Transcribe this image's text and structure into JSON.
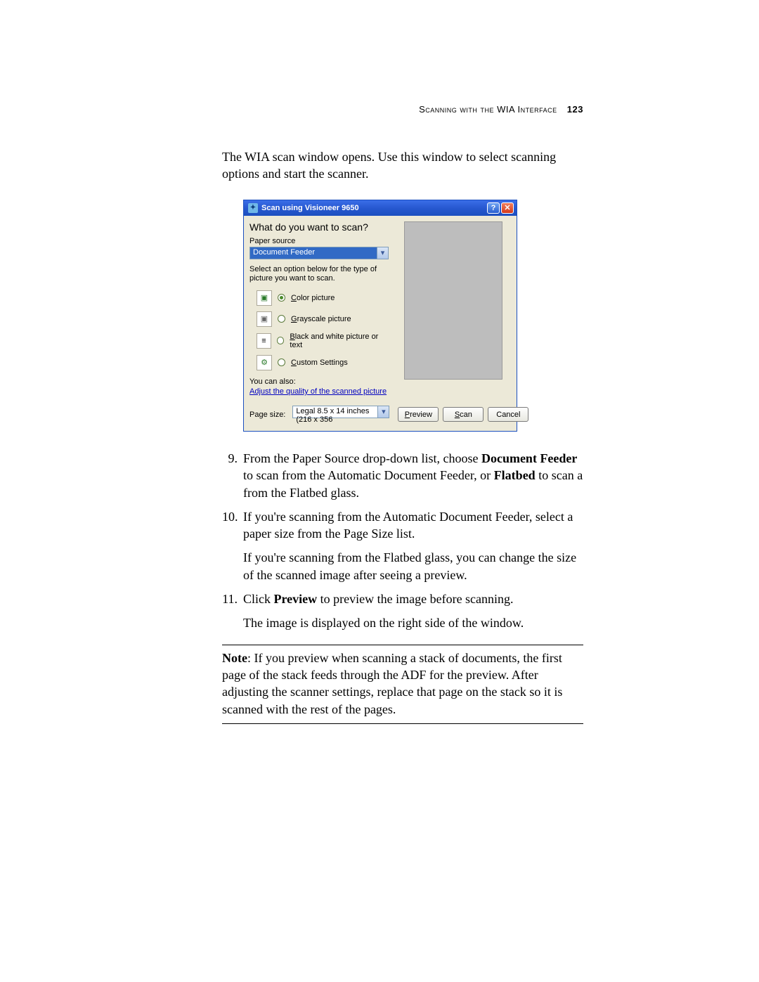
{
  "header": {
    "section": "Scanning with the WIA Interface",
    "page_number": "123"
  },
  "intro": "The WIA scan window opens. Use this window to select scanning options and start the scanner.",
  "dialog": {
    "title": "Scan using Visioneer 9650",
    "heading": "What do you want to scan?",
    "paper_source_label": "Paper source",
    "paper_source_value": "Document Feeder",
    "instruction": "Select an option below for the type of picture you want to scan.",
    "options": {
      "color": {
        "prefix": "C",
        "rest": "olor picture"
      },
      "grayscale": {
        "prefix": "G",
        "rest": "rayscale picture"
      },
      "bw": {
        "prefix": "B",
        "rest": "lack and white picture or text"
      },
      "custom": {
        "prefix": "C",
        "rest": "ustom Settings"
      }
    },
    "you_can_also": "You can also:",
    "adjust_link": "Adjust the quality of the scanned picture",
    "page_size_label": "Page size:",
    "page_size_value": "Legal 8.5 x 14 inches (216 x 356",
    "buttons": {
      "preview": {
        "prefix": "P",
        "rest": "review"
      },
      "scan": {
        "prefix": "S",
        "rest": "can"
      },
      "cancel": "Cancel"
    }
  },
  "steps": {
    "s9": {
      "num": "9.",
      "pre": "From the Paper Source drop-down list, choose ",
      "bold1": "Document Feeder",
      "mid": " to scan from the Automatic Document Feeder, or ",
      "bold2": "Flatbed",
      "post": " to scan a from the Flatbed glass."
    },
    "s10": {
      "num": "10.",
      "p1": "If you're scanning from the Automatic Document Feeder, select a paper size from the Page Size list.",
      "p2": "If you're scanning from the Flatbed glass, you can change the size of the scanned image after seeing a preview."
    },
    "s11": {
      "num": "11.",
      "pre": "Click ",
      "bold": "Preview",
      "post": " to preview the image before scanning.",
      "p2": "The image is displayed on the right side of the window."
    }
  },
  "note": {
    "label": "Note",
    "text": ":  If you preview when scanning a stack of documents, the first page of the stack feeds through the ADF for the preview. After adjusting the scanner settings, replace that page on the stack so it is scanned with the rest of the pages."
  }
}
